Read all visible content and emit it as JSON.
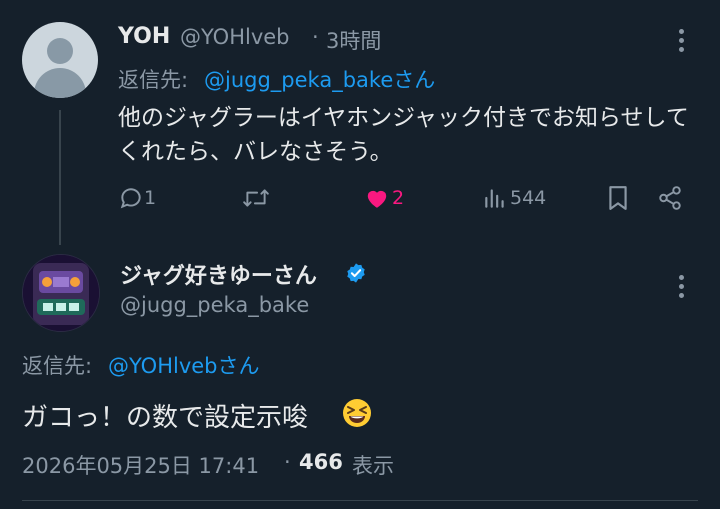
{
  "reply_tweet": {
    "name": "YOH",
    "handle": "@YOHlveb",
    "separator": "·",
    "time": "3時間",
    "reply_to_prefix": "返信先:",
    "reply_to_handle": "@jugg_peka_bakeさん",
    "text": "他のジャグラーはイヤホンジャック付きでお知らせしてくれたら、バレなさそう。",
    "actions": {
      "replies": "1",
      "retweets": "",
      "likes": "2",
      "views": "544"
    },
    "like_color": "#f91880"
  },
  "main_tweet": {
    "name": "ジャグ好きゆーさん",
    "verified": true,
    "handle": "@jugg_peka_bake",
    "reply_to_prefix": "返信先:",
    "reply_to_handle": "@YOHlvebさん",
    "text": "ガコっ！の数で設定示唆",
    "emoji": "grinning-squinting-face",
    "date": "2026年05月25日 17:41",
    "separator": "·",
    "views_count": "466",
    "views_label": "表示"
  },
  "colors": {
    "background": "#15202b",
    "text": "#e7e9ea",
    "secondary": "#8b98a5",
    "link": "#1d9bf0",
    "like": "#f91880"
  }
}
